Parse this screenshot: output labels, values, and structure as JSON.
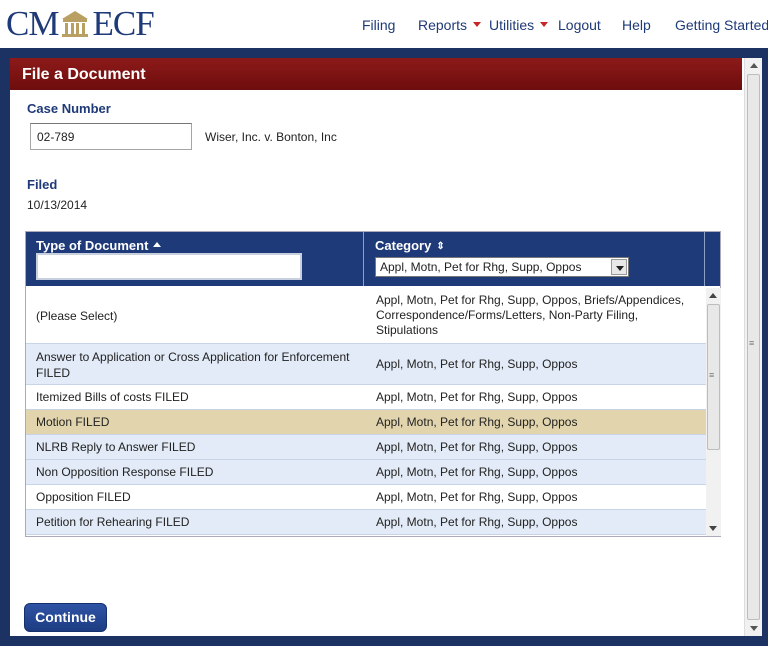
{
  "header": {
    "logo_left": "CM",
    "logo_right": "ECF",
    "nav": [
      {
        "label": "Filing",
        "dropdown": false
      },
      {
        "label": "Reports",
        "dropdown": true
      },
      {
        "label": "Utilities",
        "dropdown": true
      },
      {
        "label": "Logout",
        "dropdown": false
      },
      {
        "label": "Help",
        "dropdown": false
      },
      {
        "label": "Getting Started",
        "dropdown": false
      }
    ]
  },
  "panel": {
    "title": "File a Document",
    "case_number_label": "Case Number",
    "case_number_value": "02-789",
    "case_title": "Wiser, Inc. v. Bonton, Inc",
    "filed_label": "Filed",
    "filed_value": "10/13/2014",
    "continue_label": "Continue"
  },
  "table": {
    "col1_header": "Type of Document",
    "col2_header": "Category",
    "type_filter_value": "",
    "category_selected": "Appl, Motn, Pet for Rhg, Supp, Oppos",
    "rows": [
      {
        "type": "(Please Select)",
        "category": "Appl, Motn, Pet for Rhg, Supp, Oppos, Briefs/Appendices, Correspondence/Forms/Letters, Non-Party Filing, Stipulations"
      },
      {
        "type": "Answer to Application or Cross Application for Enforcement FILED",
        "category": "Appl, Motn, Pet for Rhg, Supp, Oppos"
      },
      {
        "type": "Itemized Bills of costs FILED",
        "category": "Appl, Motn, Pet for Rhg, Supp, Oppos"
      },
      {
        "type": "Motion FILED",
        "category": "Appl, Motn, Pet for Rhg, Supp, Oppos"
      },
      {
        "type": "NLRB Reply to Answer FILED",
        "category": "Appl, Motn, Pet for Rhg, Supp, Oppos"
      },
      {
        "type": "Non Opposition Response FILED",
        "category": "Appl, Motn, Pet for Rhg, Supp, Oppos"
      },
      {
        "type": "Opposition FILED",
        "category": "Appl, Motn, Pet for Rhg, Supp, Oppos"
      },
      {
        "type": "Petition for Rehearing FILED",
        "category": "Appl, Motn, Pet for Rhg, Supp, Oppos"
      }
    ]
  },
  "colors": {
    "brand_blue": "#1f3a78",
    "title_red": "#8d1a1a",
    "row_alt": "#e2ebf7",
    "row_selected": "#e2d5ad",
    "caret_red": "#c62828"
  }
}
